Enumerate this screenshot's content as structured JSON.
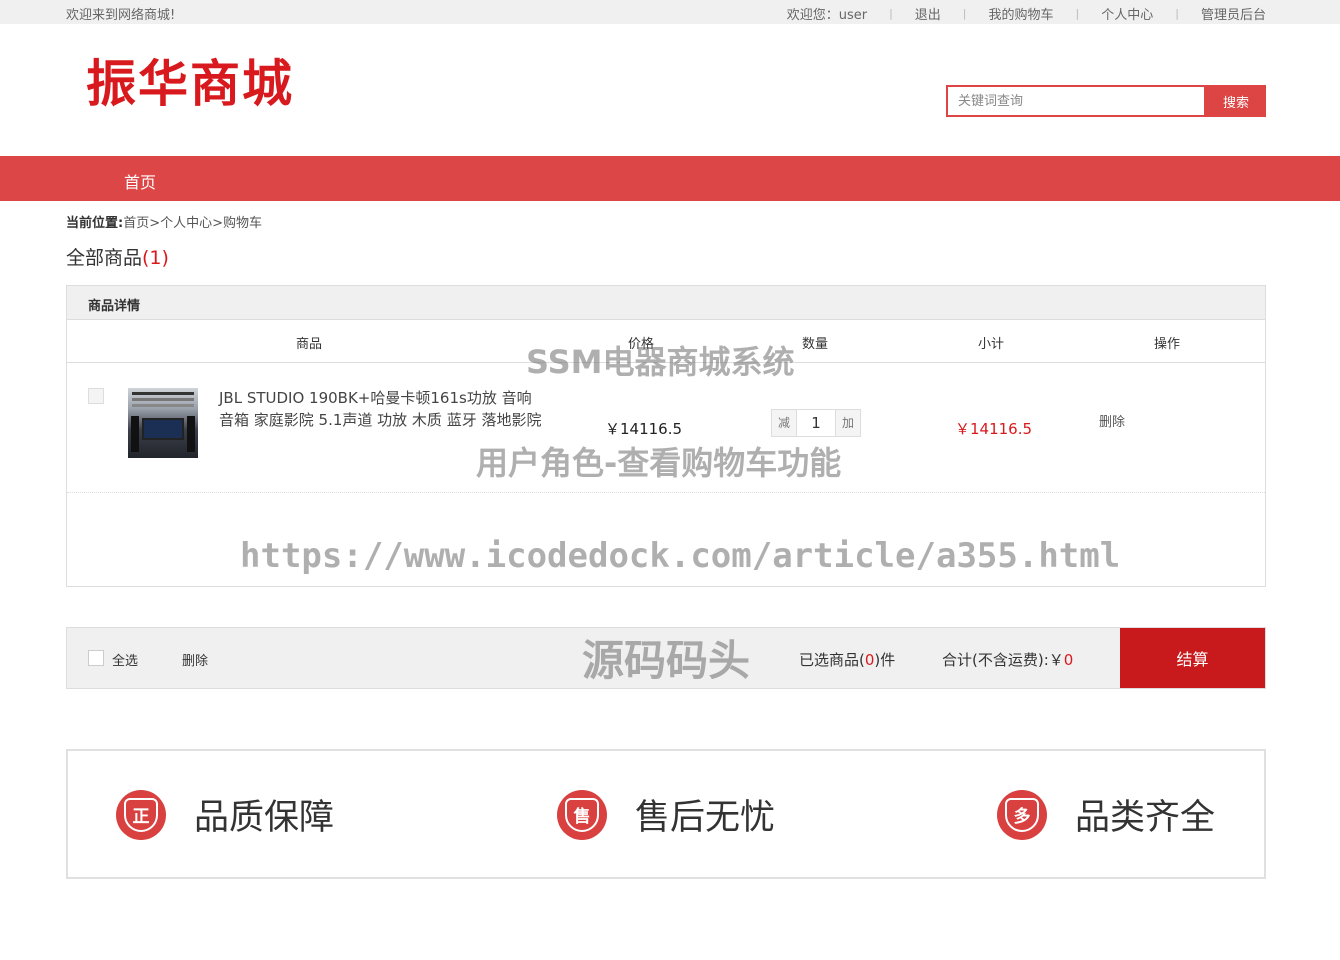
{
  "topbar": {
    "welcome": "欢迎来到网络商城!",
    "user_greeting": "欢迎您：user",
    "logout": "退出",
    "my_cart": "我的购物车",
    "personal_center": "个人中心",
    "admin": "管理员后台"
  },
  "header": {
    "logo": "振华商城",
    "search_placeholder": "关键词查询",
    "search_button": "搜索"
  },
  "nav": {
    "home": "首页"
  },
  "breadcrumb": {
    "prefix": "当前位置:",
    "path": "首页>个人中心>购物车"
  },
  "all_goods": {
    "label": "全部商品",
    "count": "(1)"
  },
  "cart": {
    "section_title": "商品详情",
    "columns": [
      "商品",
      "价格",
      "数量",
      "小计",
      "操作"
    ],
    "items": [
      {
        "name": "JBL STUDIO 190BK+哈曼卡顿161s功放 音响 音箱 家庭影院 5.1声道 功放 木质 蓝牙 落地影院",
        "price": "￥14116.5",
        "qty_minus": "减",
        "qty": "1",
        "qty_plus": "加",
        "subtotal": "￥14116.5",
        "delete": "删除"
      }
    ]
  },
  "footer_bar": {
    "select_all": "全选",
    "delete": "删除",
    "selected_prefix": "已选商品(",
    "selected_count": "0",
    "selected_suffix": ")件",
    "total_label": "合计(不含运费):￥",
    "total_value": "0",
    "checkout": "结算"
  },
  "features": [
    {
      "icon": "quality-badge-icon",
      "glyph": "正",
      "label": "品质保障"
    },
    {
      "icon": "after-sale-icon",
      "glyph": "售",
      "label": "售后无忧"
    },
    {
      "icon": "variety-icon",
      "glyph": "多",
      "label": "品类齐全"
    }
  ],
  "watermarks": {
    "w1": "SSM电器商城系统",
    "w2": "用户角色-查看购物车功能",
    "w3": "https://www.icodedock.com/article/a355.html",
    "w4": "源码码头"
  }
}
